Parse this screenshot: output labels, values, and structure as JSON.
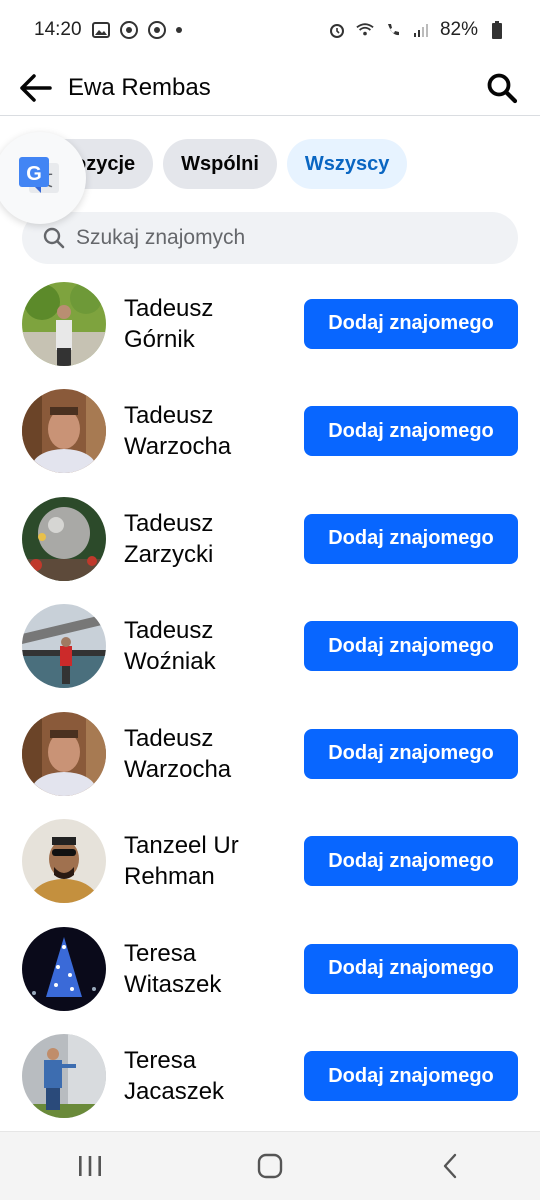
{
  "status_bar": {
    "time": "14:20",
    "battery": "82%"
  },
  "header": {
    "title": "Ewa Rembas"
  },
  "tabs": [
    {
      "label": "Propozycje",
      "visible_text": "ozycje",
      "active": false
    },
    {
      "label": "Wspólni",
      "active": false
    },
    {
      "label": "Wszyscy",
      "active": true
    }
  ],
  "search": {
    "placeholder": "Szukaj znajomych",
    "value": ""
  },
  "friends": [
    {
      "first": "Tadeusz",
      "last": "Górnik",
      "button": "Dodaj znajomego"
    },
    {
      "first": "Tadeusz",
      "last": "Warzocha",
      "button": "Dodaj znajomego"
    },
    {
      "first": "Tadeusz",
      "last": "Zarzycki",
      "button": "Dodaj znajomego"
    },
    {
      "first": "Tadeusz",
      "last": "Woźniak",
      "button": "Dodaj znajomego"
    },
    {
      "first": "Tadeusz",
      "last": "Warzocha",
      "button": "Dodaj znajomego"
    },
    {
      "first": "Tanzeel Ur",
      "last": "Rehman",
      "button": "Dodaj znajomego"
    },
    {
      "first": "Teresa",
      "last": "Witaszek",
      "button": "Dodaj znajomego"
    },
    {
      "first": "Teresa",
      "last": "Jacaszek",
      "button": "Dodaj znajomego"
    }
  ],
  "colors": {
    "primary": "#0866ff",
    "active_tab_bg": "#e7f3ff",
    "active_tab_text": "#0a66c2",
    "tab_bg": "#e4e6eb"
  },
  "icons": {
    "back": "arrow-left-icon",
    "search": "magnifier-icon",
    "translate": "google-translate-icon",
    "nav_recents": "recents-icon",
    "nav_home": "home-icon",
    "nav_back": "back-chevron-icon"
  }
}
